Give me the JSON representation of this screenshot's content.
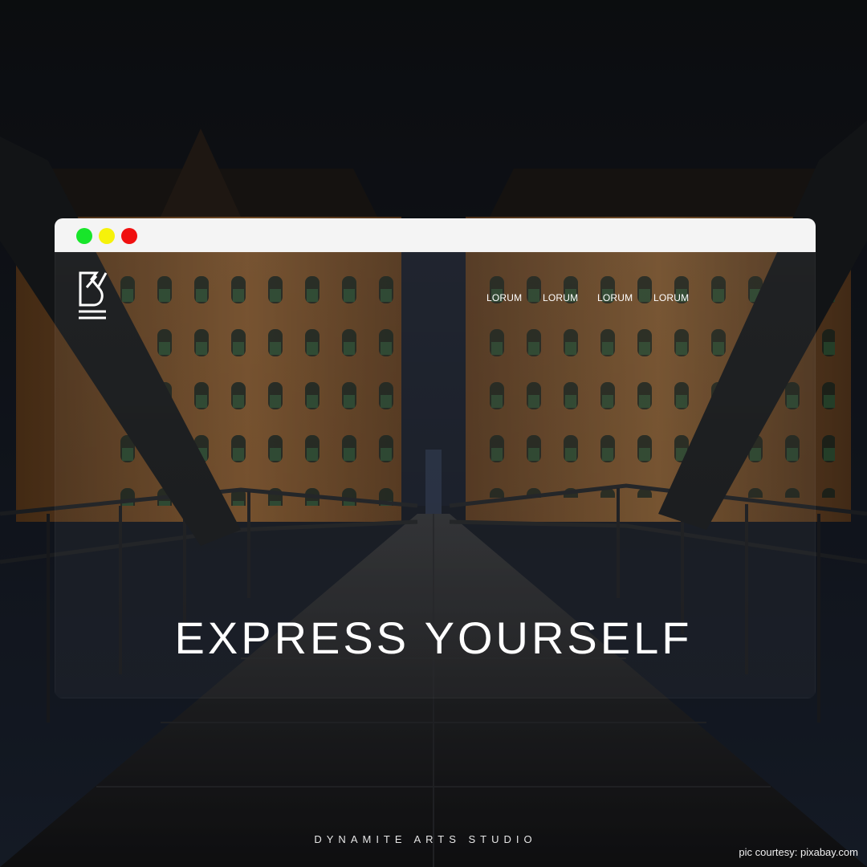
{
  "window": {
    "controls": [
      {
        "name": "maximize",
        "color": "#18e52a"
      },
      {
        "name": "minimize",
        "color": "#f6f20a"
      },
      {
        "name": "close",
        "color": "#f01010"
      }
    ]
  },
  "site": {
    "logo_icon": "studio-monogram-logo",
    "nav": [
      "LORUM",
      "LORUM",
      "LORUM",
      "LORUM"
    ]
  },
  "hero": {
    "headline": "EXPRESS YOURSELF"
  },
  "footer": {
    "studio": "DYNAMITE ARTS STUDIO",
    "credit": "pic courtesy: pixabay.com"
  },
  "colors": {
    "brick": "#8a5a2c",
    "sky": "#151a26",
    "titlebar": "#f4f4f4"
  }
}
